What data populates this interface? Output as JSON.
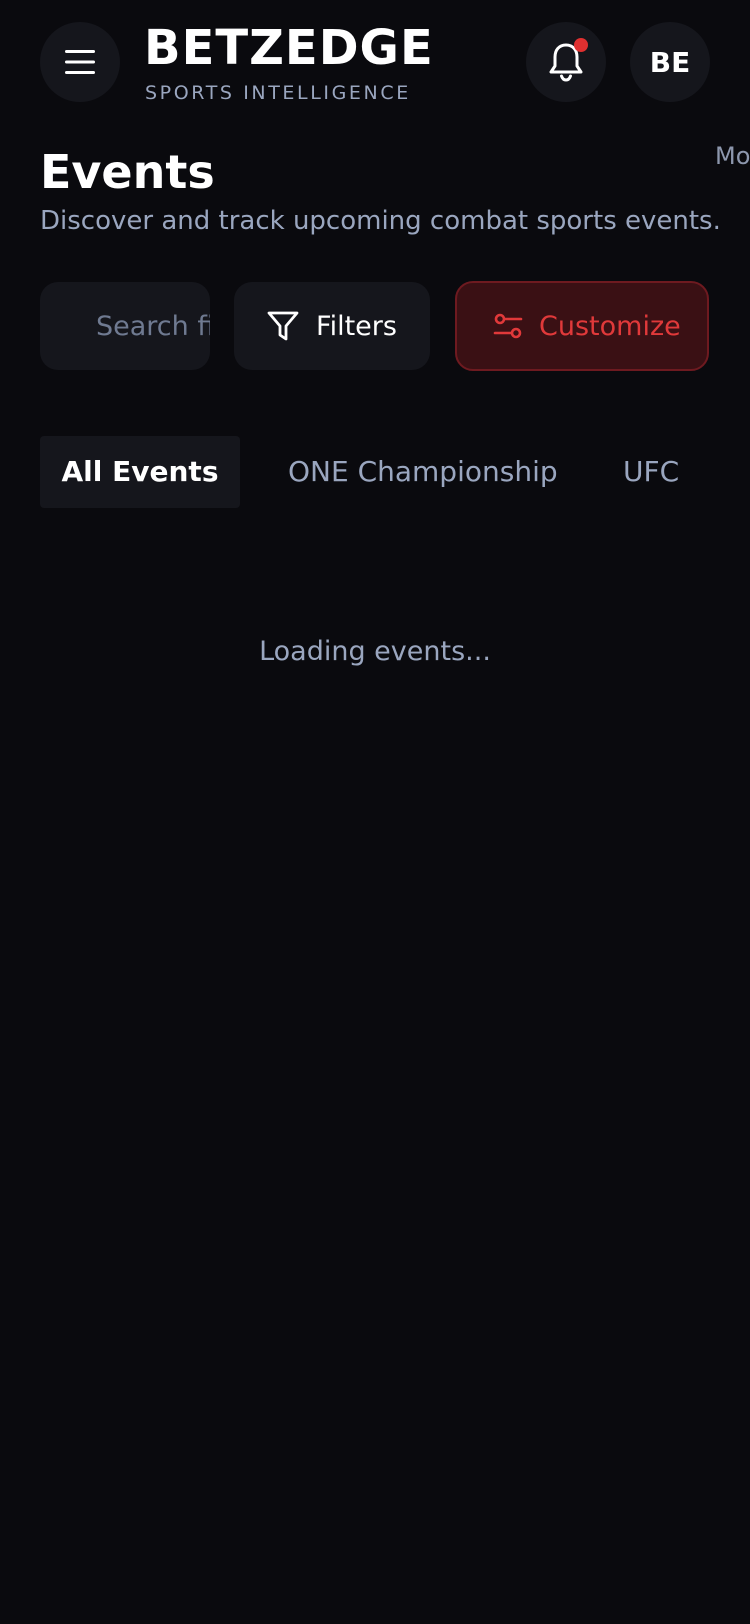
{
  "header": {
    "brand": "BETZEDGE",
    "tagline": "SPORTS INTELLIGENCE",
    "avatar_initials": "BE",
    "menu_icon": "hamburger-menu-icon",
    "bell_icon": "bell-icon"
  },
  "page": {
    "title": "Events",
    "subtitle": "Discover and track upcoming combat sports events.",
    "more_link": "Mo"
  },
  "controls": {
    "search_placeholder": "Search fighters...",
    "filters_label": "Filters",
    "customize_label": "Customize"
  },
  "tabs": [
    {
      "label": "All Events",
      "active": true
    },
    {
      "label": "ONE Championship",
      "active": false
    },
    {
      "label": "UFC",
      "active": false
    }
  ],
  "status": {
    "loading_text": "Loading events..."
  },
  "colors": {
    "background": "#0a0a0e",
    "surface": "#15161c",
    "accent_red": "#e0393a",
    "muted_text": "#9aa6bf"
  }
}
